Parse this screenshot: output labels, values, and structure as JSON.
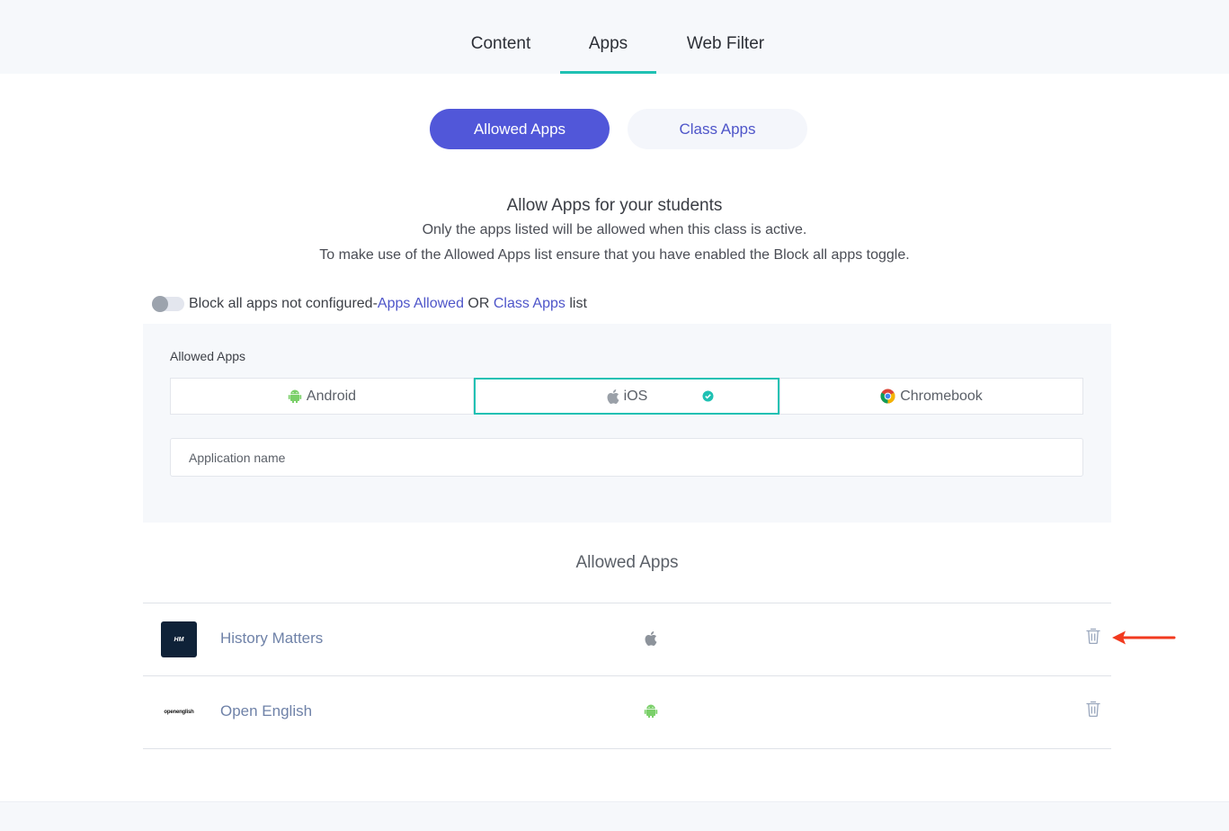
{
  "tabs": [
    {
      "label": "Content",
      "active": false
    },
    {
      "label": "Apps",
      "active": true
    },
    {
      "label": "Web Filter",
      "active": false
    }
  ],
  "segment": {
    "allowed_label": "Allowed Apps",
    "class_label": "Class Apps"
  },
  "intro": {
    "title": "Allow Apps for your students",
    "line1": "Only the apps listed will be allowed when this class is active.",
    "line2": "To make use of the Allowed Apps list ensure that you have enabled the Block all apps toggle."
  },
  "block_toggle": {
    "on": false,
    "text": "Block all apps not configured-",
    "link1": "Apps Allowed",
    "or_text": " OR ",
    "link2": "Class Apps",
    "suffix": " list"
  },
  "panel": {
    "label": "Allowed Apps",
    "platforms": [
      {
        "label": "Android",
        "icon": "android-icon"
      },
      {
        "label": "iOS",
        "icon": "apple-icon",
        "selected": true
      },
      {
        "label": "Chromebook",
        "icon": "chrome-icon"
      }
    ],
    "input_placeholder": "Application name"
  },
  "list": {
    "title": "Allowed Apps",
    "apps": [
      {
        "logo_text": "HM",
        "name": "History Matters",
        "platform_icon": "apple-icon"
      },
      {
        "logo_text": "openenglish",
        "name": "Open English",
        "platform_icon": "android-icon"
      }
    ]
  },
  "colors": {
    "accent": "#5157d9",
    "teal": "#1fc1b3",
    "arrow": "#f23a1f",
    "android": "#7bd06a"
  }
}
